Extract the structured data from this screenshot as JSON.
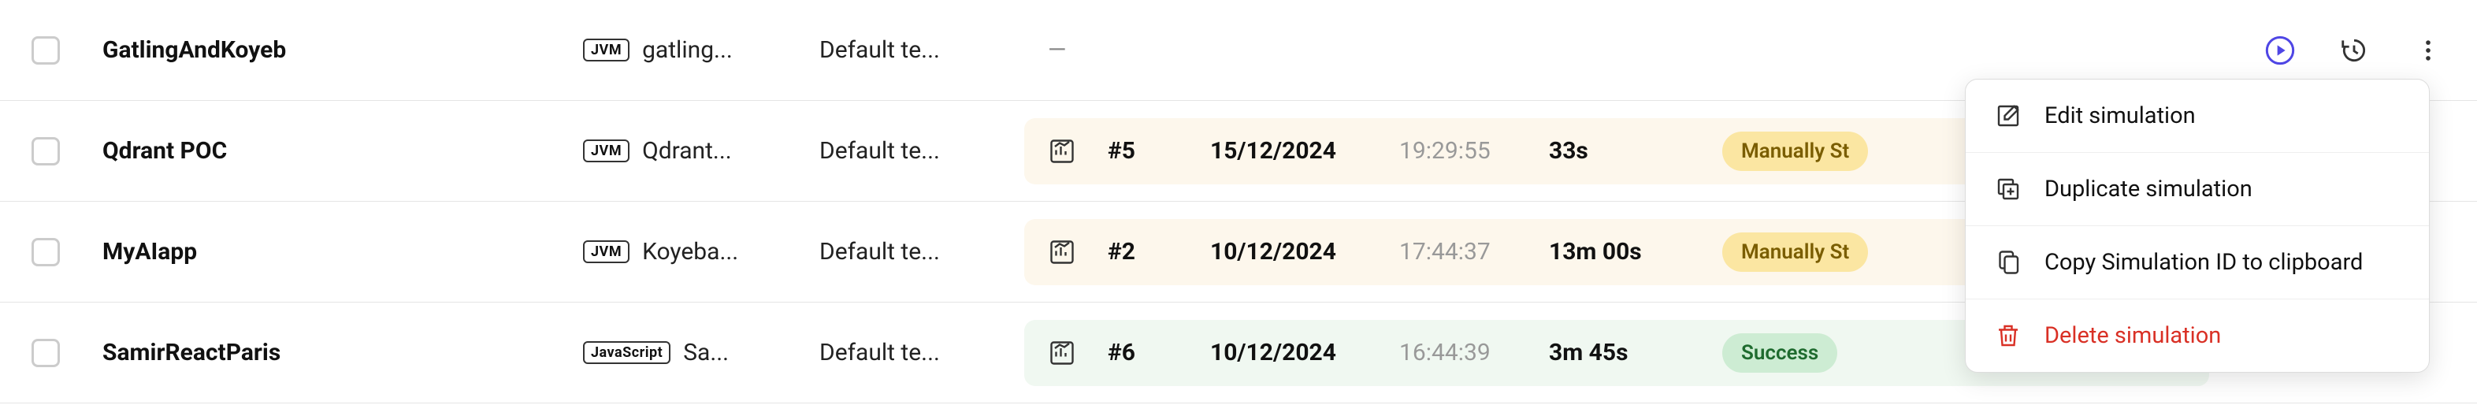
{
  "rows": [
    {
      "name": "GatlingAndKoyeb",
      "lang_badge": "JVM",
      "lang_name": "gatling...",
      "team": "Default te...",
      "run": null,
      "placeholder": "—"
    },
    {
      "name": "Qdrant POC",
      "lang_badge": "JVM",
      "lang_name": "Qdrant...",
      "team": "Default te...",
      "run": {
        "num": "#5",
        "date": "15/12/2024",
        "time": "19:29:55",
        "duration": "33s",
        "status_kind": "warn",
        "status": "Manually St"
      }
    },
    {
      "name": "MyAIapp",
      "lang_badge": "JVM",
      "lang_name": "Koyeba...",
      "team": "Default te...",
      "run": {
        "num": "#2",
        "date": "10/12/2024",
        "time": "17:44:37",
        "duration": "13m 00s",
        "status_kind": "warn",
        "status": "Manually St"
      }
    },
    {
      "name": "SamirReactParis",
      "lang_badge": "JavaScript",
      "lang_name": "Sa...",
      "team": "Default te...",
      "run": {
        "num": "#6",
        "date": "10/12/2024",
        "time": "16:44:39",
        "duration": "3m 45s",
        "status_kind": "success",
        "status": "Success"
      }
    }
  ],
  "menu": {
    "edit": "Edit simulation",
    "duplicate": "Duplicate simulation",
    "copy": "Copy Simulation ID to clipboard",
    "delete": "Delete simulation"
  },
  "colors": {
    "accent": "#4f46e5",
    "danger": "#d93025"
  }
}
